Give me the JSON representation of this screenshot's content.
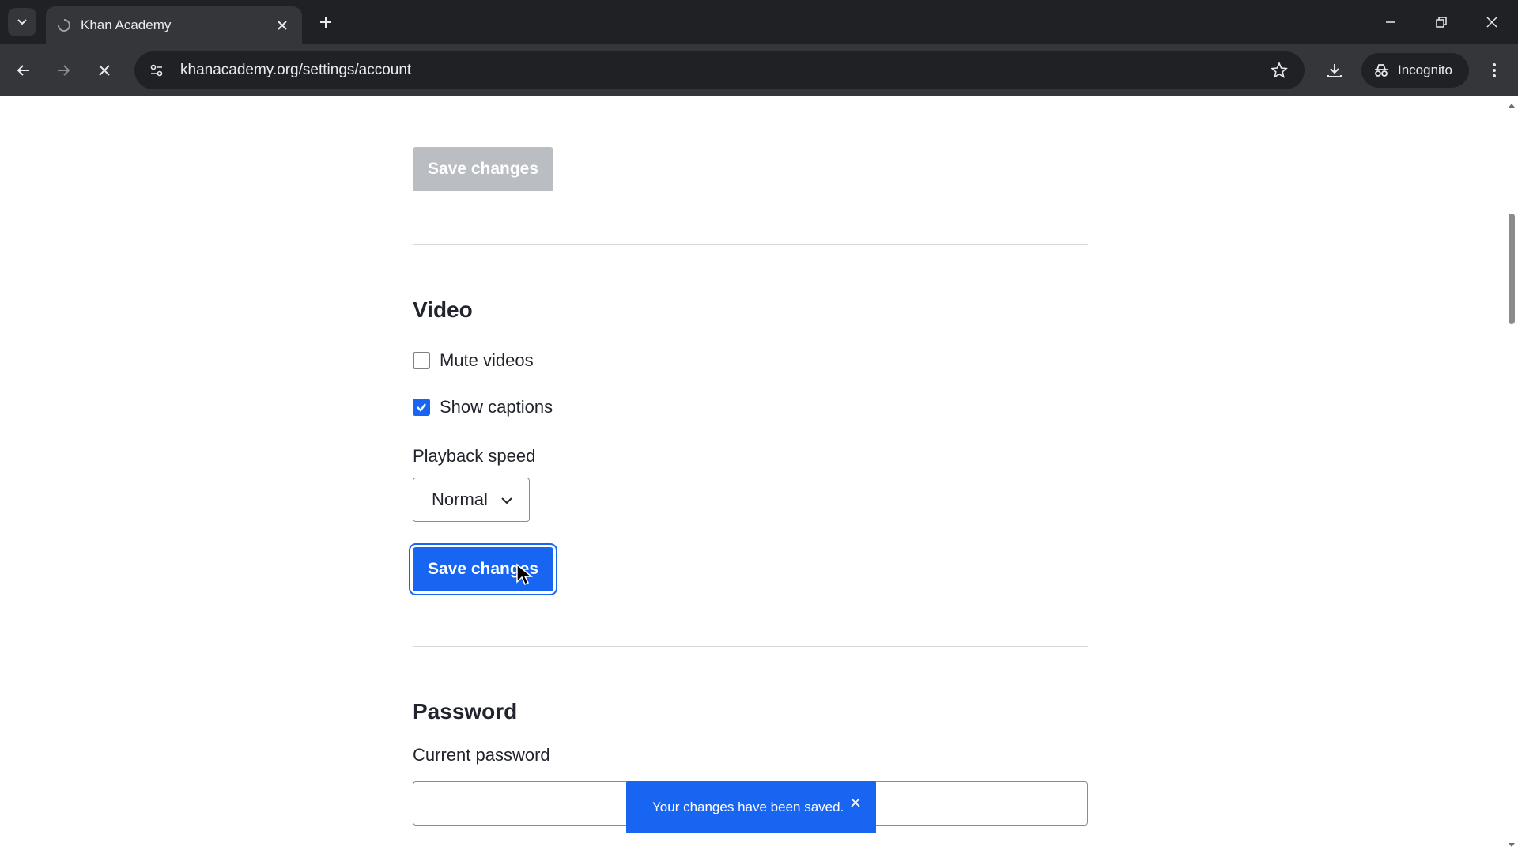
{
  "browser": {
    "tab_title": "Khan Academy",
    "url": "khanacademy.org/settings/account",
    "incognito_label": "Incognito",
    "icons": {
      "tab_search": "chevron-down-icon",
      "favicon": "loading-icon",
      "tab_close": "close-icon",
      "new_tab": "plus-icon",
      "back": "arrow-left-icon",
      "forward": "arrow-right-icon",
      "stop": "close-icon",
      "site_info": "tune-icon",
      "bookmark": "star-icon",
      "download": "download-icon",
      "incognito": "incognito-icon",
      "menu": "more-vert-icon"
    }
  },
  "page": {
    "top_save_button": "Save changes",
    "video": {
      "title": "Video",
      "mute_videos": {
        "label": "Mute videos",
        "checked": false
      },
      "show_captions": {
        "label": "Show captions",
        "checked": true
      },
      "playback_speed_label": "Playback speed",
      "playback_speed_value": "Normal",
      "save_button": "Save changes"
    },
    "password": {
      "title": "Password",
      "current_password_label": "Current password",
      "current_password_value": ""
    }
  },
  "toast": {
    "message": "Your changes have been saved."
  },
  "colors": {
    "primary": "#1865f2",
    "disabled": "#babec2",
    "chrome_dark": "#202124",
    "chrome_mid": "#35363a"
  }
}
